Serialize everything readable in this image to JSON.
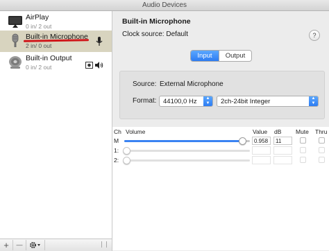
{
  "window": {
    "title": "Audio Devices"
  },
  "sidebar": {
    "devices": [
      {
        "name": "AirPlay",
        "io": "0 in/ 2 out",
        "icon": "display-icon"
      },
      {
        "name": "Built-in Microphone",
        "io": "2 in/ 0 out",
        "icon": "microphone-icon",
        "selected": true
      },
      {
        "name": "Built-in Output",
        "io": "0 in/ 2 out",
        "icon": "speaker-icon"
      }
    ],
    "bottom": {
      "add": "+",
      "minus": "—"
    }
  },
  "detail": {
    "title": "Built-in Microphone",
    "clock_label": "Clock source:",
    "clock_value": "Default",
    "help": "?",
    "tabs": {
      "input": "Input",
      "output": "Output",
      "selected": "Input"
    },
    "source_label": "Source:",
    "source_value": "External Microphone",
    "format_label": "Format:",
    "rate": "44100,0 Hz",
    "format": "2ch-24bit Integer"
  },
  "channels": {
    "headers": {
      "ch": "Ch",
      "volume": "Volume",
      "value": "Value",
      "db": "dB",
      "mute": "Mute",
      "thru": "Thru"
    },
    "rows": [
      {
        "ch": "M",
        "level": 0.958,
        "value": "0.958",
        "db": "11",
        "enabled": true
      },
      {
        "ch": "1:",
        "level": 0,
        "value": "",
        "db": "",
        "enabled": false
      },
      {
        "ch": "2:",
        "level": 0,
        "value": "",
        "db": "",
        "enabled": false
      }
    ]
  },
  "colors": {
    "accent": "#2d7cf2",
    "selection": "#d8d4bf",
    "annotation": "#d0161a"
  }
}
